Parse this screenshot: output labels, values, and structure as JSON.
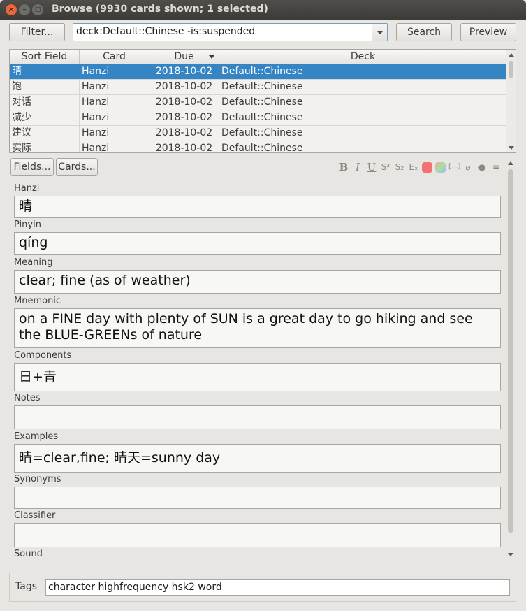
{
  "window": {
    "title": "Browse (9930 cards shown; 1 selected)",
    "close_glyph": "×",
    "min_glyph": "–",
    "max_glyph": "□"
  },
  "toolbar": {
    "filter_label": "Filter...",
    "search_value": "deck:Default::Chinese -is:suspended",
    "search_label": "Search",
    "preview_label": "Preview"
  },
  "table": {
    "headers": [
      "Sort Field",
      "Card",
      "Due",
      "Deck"
    ],
    "sorted_column": "Due",
    "rows": [
      {
        "sort_field": "晴",
        "card": "Hanzi",
        "due": "2018-10-02",
        "deck": "Default::Chinese",
        "selected": true
      },
      {
        "sort_field": "饱",
        "card": "Hanzi",
        "due": "2018-10-02",
        "deck": "Default::Chinese",
        "selected": false
      },
      {
        "sort_field": "对话",
        "card": "Hanzi",
        "due": "2018-10-02",
        "deck": "Default::Chinese",
        "selected": false
      },
      {
        "sort_field": "减少",
        "card": "Hanzi",
        "due": "2018-10-02",
        "deck": "Default::Chinese",
        "selected": false
      },
      {
        "sort_field": "建议",
        "card": "Hanzi",
        "due": "2018-10-02",
        "deck": "Default::Chinese",
        "selected": false
      },
      {
        "sort_field": "实际",
        "card": "Hanzi",
        "due": "2018-10-02",
        "deck": "Default::Chinese",
        "selected": false
      }
    ],
    "selected_color": "#3584c4"
  },
  "editor": {
    "fields_button": "Fields...",
    "cards_button": "Cards...",
    "icons": {
      "bold": "B",
      "italic": "I",
      "underline": "U",
      "superscript": "S²",
      "subscript": "S₂",
      "clear_format": "Eₓ",
      "cloze": "[...]",
      "attach": "⌀",
      "record": "●",
      "more": "≡"
    },
    "text_color": "#f07272",
    "fields": [
      {
        "label": "Hanzi",
        "value": "晴"
      },
      {
        "label": "Pinyin",
        "value": "qíng"
      },
      {
        "label": "Meaning",
        "value": "clear; fine (as of weather)"
      },
      {
        "label": "Mnemonic",
        "value": "on a FINE day with plenty of SUN is a great day to go hiking and see the BLUE-GREENs of nature"
      },
      {
        "label": "Components",
        "value": "日+青"
      },
      {
        "label": "Notes",
        "value": ""
      },
      {
        "label": "Examples",
        "value": "晴=clear,fine; 晴天=sunny day"
      },
      {
        "label": "Synonyms",
        "value": ""
      },
      {
        "label": "Classifier",
        "value": ""
      },
      {
        "label": "Sound",
        "value": ""
      }
    ]
  },
  "tags": {
    "label": "Tags",
    "value": "character highfrequency hsk2 word"
  }
}
